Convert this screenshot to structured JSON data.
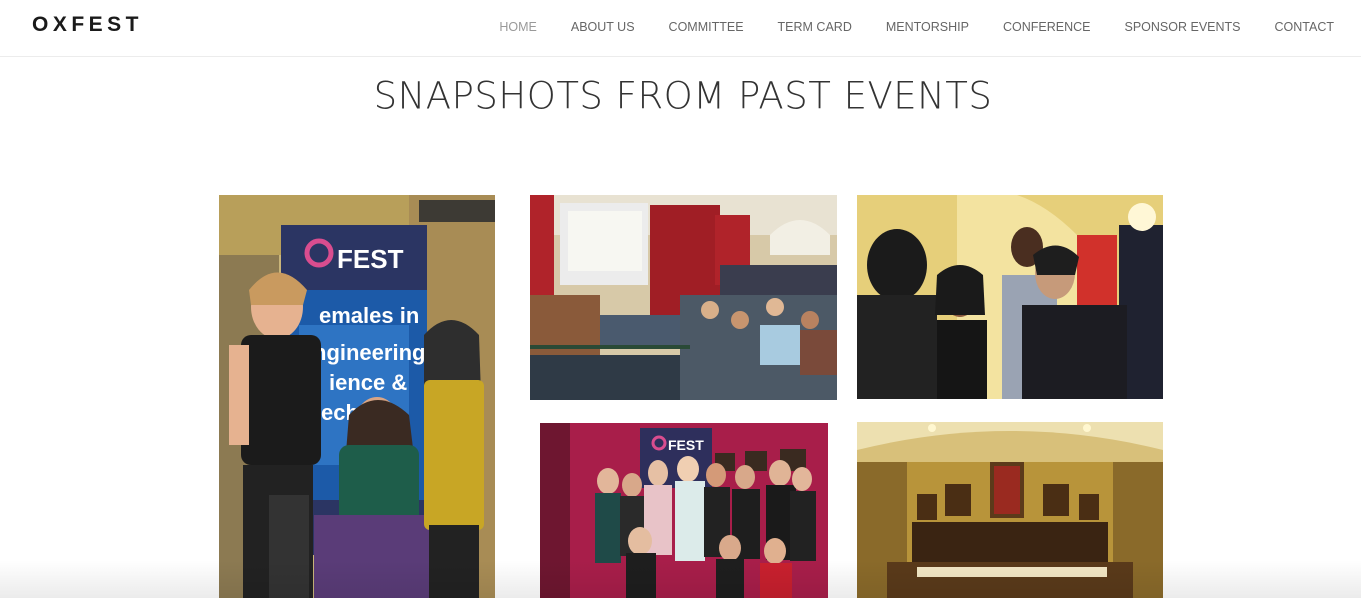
{
  "brand": {
    "logo": "OXFEST"
  },
  "nav": {
    "items": [
      {
        "label": "HOME",
        "active": true
      },
      {
        "label": "ABOUT US"
      },
      {
        "label": "COMMITTEE"
      },
      {
        "label": "TERM CARD"
      },
      {
        "label": "MENTORSHIP"
      },
      {
        "label": "CONFERENCE"
      },
      {
        "label": "SPONSOR EVENTS"
      },
      {
        "label": "CONTACT"
      }
    ]
  },
  "gallery": {
    "title": "SNAPSHOTS FROM PAST EVENTS",
    "photos": [
      {
        "id": "photo-banner-group",
        "banner_lines": [
          "FEST",
          "emales in",
          "ngineering,",
          "ience &",
          "echnol"
        ]
      },
      {
        "id": "photo-lecture-hall"
      },
      {
        "id": "photo-networking"
      },
      {
        "id": "photo-group-pink-wall",
        "banner_text": "FEST"
      },
      {
        "id": "photo-dining-hall"
      }
    ]
  }
}
